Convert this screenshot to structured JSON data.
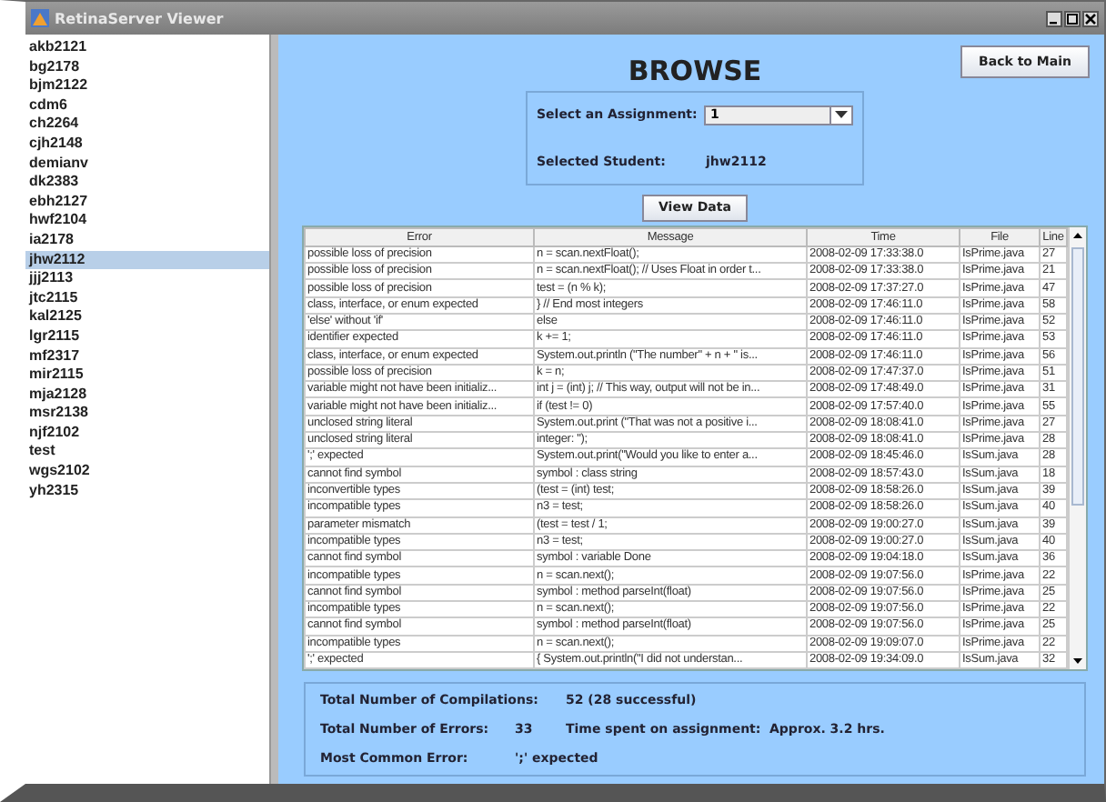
{
  "window": {
    "title": "RetinaServer Viewer"
  },
  "students": [
    {
      "name": "akb2121",
      "selected": false
    },
    {
      "name": "bg2178",
      "selected": false
    },
    {
      "name": "bjm2122",
      "selected": false
    },
    {
      "name": "cdm6",
      "selected": false
    },
    {
      "name": "ch2264",
      "selected": false
    },
    {
      "name": "cjh2148",
      "selected": false
    },
    {
      "name": "demianv",
      "selected": false
    },
    {
      "name": "dk2383",
      "selected": false
    },
    {
      "name": "ebh2127",
      "selected": false
    },
    {
      "name": "hwf2104",
      "selected": false
    },
    {
      "name": "ia2178",
      "selected": false
    },
    {
      "name": "jhw2112",
      "selected": true
    },
    {
      "name": "jjj2113",
      "selected": false
    },
    {
      "name": "jtc2115",
      "selected": false
    },
    {
      "name": "kal2125",
      "selected": false
    },
    {
      "name": "lgr2115",
      "selected": false
    },
    {
      "name": "mf2317",
      "selected": false
    },
    {
      "name": "mir2115",
      "selected": false
    },
    {
      "name": "mja2128",
      "selected": false
    },
    {
      "name": "msr2138",
      "selected": false
    },
    {
      "name": "njf2102",
      "selected": false
    },
    {
      "name": "test",
      "selected": false
    },
    {
      "name": "wgs2102",
      "selected": false
    },
    {
      "name": "yh2315",
      "selected": false
    }
  ],
  "heading": "BROWSE",
  "back_button": "Back to Main",
  "assignment": {
    "label": "Select an Assignment:",
    "value": "1"
  },
  "student": {
    "label": "Selected Student:",
    "value": "jhw2112"
  },
  "view_button": "View Data",
  "table": {
    "columns": [
      "Error",
      "Message",
      "Time",
      "File",
      "Line"
    ],
    "rows": [
      [
        "possible loss of precision",
        "n = scan.nextFloat();",
        "2008-02-09 17:33:38.0",
        "IsPrime.java",
        "27"
      ],
      [
        "possible loss of precision",
        "n = scan.nextFloat(); // Uses Float in order t...",
        "2008-02-09 17:33:38.0",
        "IsPrime.java",
        "21"
      ],
      [
        "possible loss of precision",
        "test = (n % k);",
        "2008-02-09 17:37:27.0",
        "IsPrime.java",
        "47"
      ],
      [
        "class, interface, or enum expected",
        "} // End most integers",
        "2008-02-09 17:46:11.0",
        "IsPrime.java",
        "58"
      ],
      [
        "'else' without 'if'",
        "else",
        "2008-02-09 17:46:11.0",
        "IsPrime.java",
        "52"
      ],
      [
        "identifier expected",
        "k += 1;",
        "2008-02-09 17:46:11.0",
        "IsPrime.java",
        "53"
      ],
      [
        "class, interface, or enum expected",
        "System.out.println (\"The number\" + n + \" is...",
        "2008-02-09 17:46:11.0",
        "IsPrime.java",
        "56"
      ],
      [
        "possible loss of precision",
        "k = n;",
        "2008-02-09 17:47:37.0",
        "IsPrime.java",
        "51"
      ],
      [
        "variable might not have been initializ...",
        "int j = (int) j; // This way, output will not be in...",
        "2008-02-09 17:48:49.0",
        "IsPrime.java",
        "31"
      ],
      [
        "variable might not have been initializ...",
        "if (test != 0)",
        "2008-02-09 17:57:40.0",
        "IsPrime.java",
        "55"
      ],
      [
        "unclosed string literal",
        "System.out.print (\"That was not a positive i...",
        "2008-02-09 18:08:41.0",
        "IsPrime.java",
        "27"
      ],
      [
        "unclosed string literal",
        "integer: \");",
        "2008-02-09 18:08:41.0",
        "IsPrime.java",
        "28"
      ],
      [
        "';' expected",
        "System.out.print(\"Would you like to enter a...",
        "2008-02-09 18:45:46.0",
        "IsSum.java",
        "28"
      ],
      [
        "cannot find symbol",
        "symbol  : class string",
        "2008-02-09 18:57:43.0",
        "IsSum.java",
        "18"
      ],
      [
        "inconvertible types",
        "(test = (int) test;",
        "2008-02-09 18:58:26.0",
        "IsSum.java",
        "39"
      ],
      [
        "incompatible types",
        "n3 = test;",
        "2008-02-09 18:58:26.0",
        "IsSum.java",
        "40"
      ],
      [
        "parameter mismatch",
        "(test =  test / 1;",
        "2008-02-09 19:00:27.0",
        "IsSum.java",
        "39"
      ],
      [
        "incompatible types",
        "n3 = test;",
        "2008-02-09 19:00:27.0",
        "IsSum.java",
        "40"
      ],
      [
        "cannot find symbol",
        "symbol  : variable Done",
        "2008-02-09 19:04:18.0",
        "IsSum.java",
        "36"
      ],
      [
        "incompatible types",
        "n  = scan.next();",
        "2008-02-09 19:07:56.0",
        "IsPrime.java",
        "22"
      ],
      [
        "cannot find symbol",
        "symbol  : method parseInt(float)",
        "2008-02-09 19:07:56.0",
        "IsPrime.java",
        "25"
      ],
      [
        "incompatible types",
        "n  = scan.next();",
        "2008-02-09 19:07:56.0",
        "IsPrime.java",
        "22"
      ],
      [
        "cannot find symbol",
        "symbol  : method parseInt(float)",
        "2008-02-09 19:07:56.0",
        "IsPrime.java",
        "25"
      ],
      [
        "incompatible types",
        "n  = scan.next();",
        "2008-02-09 19:09:07.0",
        "IsPrime.java",
        "22"
      ],
      [
        "';' expected",
        "{       System.out.println(\"I did not understan...",
        "2008-02-09 19:34:09.0",
        "IsSum.java",
        "32"
      ]
    ]
  },
  "summary": {
    "compilations_label": "Total Number of Compilations:",
    "compilations_value": "52  (28 successful)",
    "errors_label": "Total Number of Errors:",
    "errors_value": "33",
    "time_label": "Time spent on assignment:",
    "time_value": "Approx. 3.2 hrs.",
    "common_label": "Most Common Error:",
    "common_value": "';' expected"
  }
}
